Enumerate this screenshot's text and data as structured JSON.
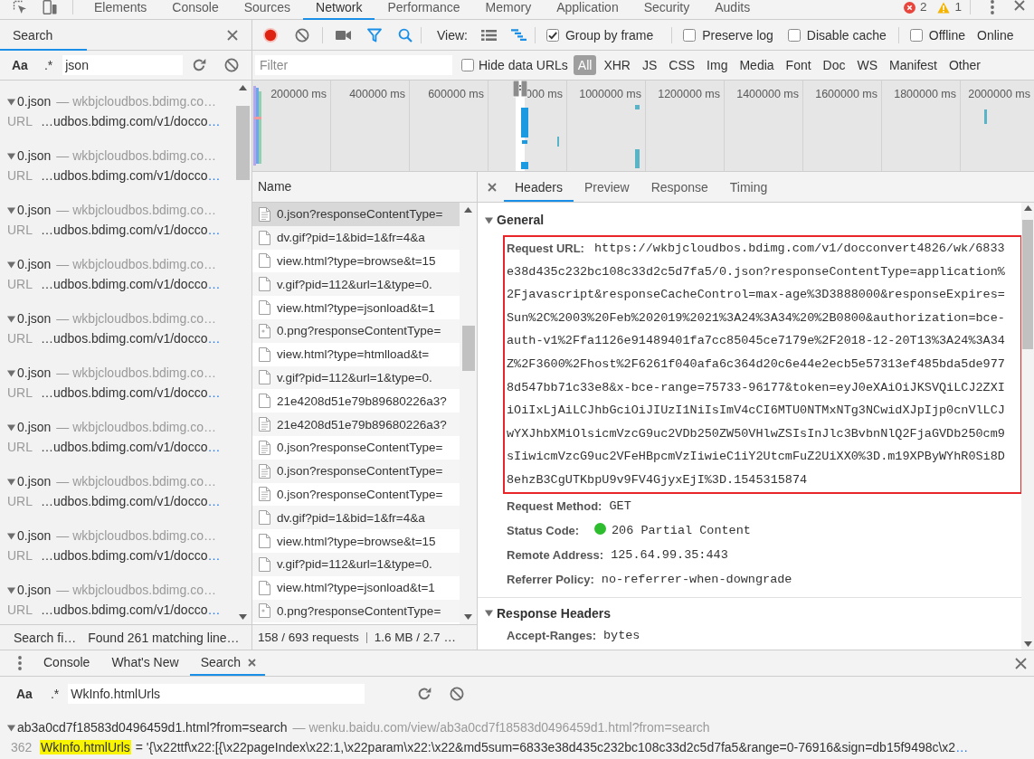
{
  "toolbar": {
    "tabs": [
      {
        "label": "Elements",
        "selected": false
      },
      {
        "label": "Console",
        "selected": false
      },
      {
        "label": "Sources",
        "selected": false
      },
      {
        "label": "Network",
        "selected": true
      },
      {
        "label": "Performance",
        "selected": false
      },
      {
        "label": "Memory",
        "selected": false
      },
      {
        "label": "Application",
        "selected": false
      },
      {
        "label": "Security",
        "selected": false
      },
      {
        "label": "Audits",
        "selected": false
      }
    ],
    "errors": "2",
    "warnings": "1"
  },
  "search_panel": {
    "tab": "Search",
    "case_toggle": "Aa",
    "regex_toggle": ".*",
    "query": "json",
    "results": [
      {
        "file": "0.json",
        "origin": "— wkbjcloudbos.bdimg.co…",
        "expanded": true,
        "url_label": "URL",
        "url": "…udbos.bdimg.com/v1/docco",
        "more": "…"
      },
      {
        "file": "0.json",
        "origin": "— wkbjcloudbos.bdimg.co…",
        "expanded": true,
        "url_label": "URL",
        "url": "…udbos.bdimg.com/v1/docco",
        "more": "…"
      },
      {
        "file": "0.json",
        "origin": "— wkbjcloudbos.bdimg.co…",
        "expanded": true,
        "url_label": "URL",
        "url": "…udbos.bdimg.com/v1/docco",
        "more": "…"
      },
      {
        "file": "0.json",
        "origin": "— wkbjcloudbos.bdimg.co…",
        "expanded": true,
        "url_label": "URL",
        "url": "…udbos.bdimg.com/v1/docco",
        "more": "…"
      },
      {
        "file": "0.json",
        "origin": "— wkbjcloudbos.bdimg.co…",
        "expanded": true,
        "url_label": "URL",
        "url": "…udbos.bdimg.com/v1/docco",
        "more": "…"
      },
      {
        "file": "0.json",
        "origin": "— wkbjcloudbos.bdimg.co…",
        "expanded": true,
        "url_label": "URL",
        "url": "…udbos.bdimg.com/v1/docco",
        "more": "…"
      },
      {
        "file": "0.json",
        "origin": "— wkbjcloudbos.bdimg.co…",
        "expanded": true,
        "url_label": "URL",
        "url": "…udbos.bdimg.com/v1/docco",
        "more": "…"
      },
      {
        "file": "0.json",
        "origin": "— wkbjcloudbos.bdimg.co…",
        "expanded": true,
        "url_label": "URL",
        "url": "…udbos.bdimg.com/v1/docco",
        "more": "…"
      },
      {
        "file": "0.json",
        "origin": "— wkbjcloudbos.bdimg.co…",
        "expanded": true,
        "url_label": "URL",
        "url": "…udbos.bdimg.com/v1/docco",
        "more": "…"
      },
      {
        "file": "0.json",
        "origin": "— wkbjcloudbos.bdimg.co…",
        "expanded": true,
        "url_label": "URL",
        "url": "…udbos.bdimg.com/v1/docco",
        "more": "…"
      }
    ],
    "status": "Search fi…",
    "summary": "Found 261 matching line…"
  },
  "network": {
    "toolbar": {
      "view_label": "View:",
      "checkboxes": [
        {
          "label": "Group by frame",
          "checked": true
        },
        {
          "label": "Preserve log",
          "checked": false
        },
        {
          "label": "Disable cache",
          "checked": false
        },
        {
          "label": "Offline",
          "checked": false
        }
      ],
      "throttle": "Online"
    },
    "filter": {
      "placeholder": "Filter",
      "hide_data_urls": {
        "label": "Hide data URLs",
        "checked": false
      },
      "types": [
        {
          "label": "All",
          "selected": true
        },
        {
          "label": "XHR",
          "selected": false
        },
        {
          "label": "JS",
          "selected": false
        },
        {
          "label": "CSS",
          "selected": false
        },
        {
          "label": "Img",
          "selected": false
        },
        {
          "label": "Media",
          "selected": false
        },
        {
          "label": "Font",
          "selected": false
        },
        {
          "label": "Doc",
          "selected": false
        },
        {
          "label": "WS",
          "selected": false
        },
        {
          "label": "Manifest",
          "selected": false
        },
        {
          "label": "Other",
          "selected": false
        }
      ]
    },
    "overview": {
      "ticks": [
        "200000 ms",
        "400000 ms",
        "600000 ms",
        "000 ms",
        "1000000 ms",
        "1200000 ms",
        "1400000 ms",
        "1600000 ms",
        "1800000 ms",
        "2000000 ms"
      ]
    },
    "requests": {
      "column": "Name",
      "rows": [
        {
          "name": "0.json?responseContentType=",
          "kind": "text",
          "selected": true
        },
        {
          "name": "dv.gif?pid=1&bid=1&fr=4&a",
          "kind": "blank",
          "selected": false
        },
        {
          "name": "view.html?type=browse&t=15",
          "kind": "blank",
          "selected": false
        },
        {
          "name": "v.gif?pid=112&url=1&type=0.",
          "kind": "blank",
          "selected": false
        },
        {
          "name": "view.html?type=jsonload&t=1",
          "kind": "blank",
          "selected": false
        },
        {
          "name": "0.png?responseContentType=",
          "kind": "image",
          "selected": false
        },
        {
          "name": "view.html?type=htmlload&t=",
          "kind": "blank",
          "selected": false
        },
        {
          "name": "v.gif?pid=112&url=1&type=0.",
          "kind": "blank",
          "selected": false
        },
        {
          "name": "21e4208d51e79b89680226a3?",
          "kind": "blank",
          "selected": false
        },
        {
          "name": "21e4208d51e79b89680226a3?",
          "kind": "text",
          "selected": false
        },
        {
          "name": "0.json?responseContentType=",
          "kind": "text",
          "selected": false
        },
        {
          "name": "0.json?responseContentType=",
          "kind": "text",
          "selected": false
        },
        {
          "name": "0.json?responseContentType=",
          "kind": "text",
          "selected": false
        },
        {
          "name": "dv.gif?pid=1&bid=1&fr=4&a",
          "kind": "blank",
          "selected": false
        },
        {
          "name": "view.html?type=browse&t=15",
          "kind": "blank",
          "selected": false
        },
        {
          "name": "v.gif?pid=112&url=1&type=0.",
          "kind": "blank",
          "selected": false
        },
        {
          "name": "view.html?type=jsonload&t=1",
          "kind": "blank",
          "selected": false
        },
        {
          "name": "0.png?responseContentType=",
          "kind": "image",
          "selected": false
        }
      ]
    },
    "status": {
      "requests": "158 / 693 requests",
      "transferred": "1.6 MB / 2.7 …"
    }
  },
  "details": {
    "tabs": [
      {
        "label": "Headers",
        "selected": true
      },
      {
        "label": "Preview",
        "selected": false
      },
      {
        "label": "Response",
        "selected": false
      },
      {
        "label": "Timing",
        "selected": false
      }
    ],
    "sections": [
      {
        "title": "General",
        "expanded": true,
        "headers": [
          {
            "name": "Request URL:",
            "value": "https://wkbjcloudbos.bdimg.com/v1/docconvert4826/wk/6833e38d435c232bc108c33d2c5d7fa5/0.json?responseContentType=application%2Fjavascript&responseCacheControl=max-age%3D3888000&responseExpires=Sun%2C%2003%20Feb%202019%2021%3A24%3A34%20%2B0800&authorization=bce-auth-v1%2Ffa1126e91489401fa7cc85045ce7179e%2F2018-12-20T13%3A24%3A34Z%2F3600%2Fhost%2F6261f040afa6c364d20c6e44e2ecb5e57313ef485bda5de9778d547bb71c33e8&x-bce-range=75733-96177&token=eyJ0eXAiOiJKSVQiLCJ2ZXIiOiIxLjAiLCJhbGciOiJIUzI1NiIsImV4cCI6MTU0NTMxNTg3NCwidXJpIjp0cnVlLCJwYXJhbXMiOlsicmVzcG9uc2VDb250ZW50VHlwZSIsInJlc3BvbnNlQ2FjaGVDb250cm9sIiwicmVzcG9uc2VFeHBpcmVzIiwieC1iY2UtcmFuZ2UiXX0%3D.m19XPByWYhR0Si8D8ehzB3CgUTKbpU9v9FV4GjyxEjI%3D.1545315874",
            "highlighted": true
          },
          {
            "name": "Request Method:",
            "value": "GET",
            "highlighted": false
          },
          {
            "name": "Status Code:",
            "value": "206 Partial Content",
            "color": "#2ebd2e",
            "highlighted": false
          },
          {
            "name": "Remote Address:",
            "value": "125.64.99.35:443",
            "highlighted": false
          },
          {
            "name": "Referrer Policy:",
            "value": "no-referrer-when-downgrade",
            "highlighted": false
          }
        ]
      },
      {
        "title": "Response Headers",
        "expanded": true,
        "headers": [
          {
            "name": "Accept-Ranges:",
            "value": "bytes",
            "highlighted": false
          }
        ]
      }
    ]
  },
  "drawer": {
    "tabs": [
      {
        "label": "Console",
        "selected": false,
        "closable": false
      },
      {
        "label": "What's New",
        "selected": false,
        "closable": false
      },
      {
        "label": "Search",
        "selected": true,
        "closable": true
      }
    ],
    "case_toggle": "Aa",
    "regex_toggle": ".*",
    "query": "WkInfo.htmlUrls",
    "result": {
      "expanded": true,
      "file": "ab3a0cd7f18583d0496459d1.html?from=search",
      "origin": "— wenku.baidu.com/view/ab3a0cd7f18583d0496459d1.html?from=search",
      "line": "362",
      "match": "WkInfo.htmlUrls",
      "text": "= '{\\x22ttf\\x22:[{\\x22pageIndex\\x22:1,\\x22param\\x22:\\x22&md5sum=6833e38d435c232bc108c33d2c5d7fa5&range=0-76916&sign=db15f9498c\\x2",
      "more": "…"
    }
  }
}
